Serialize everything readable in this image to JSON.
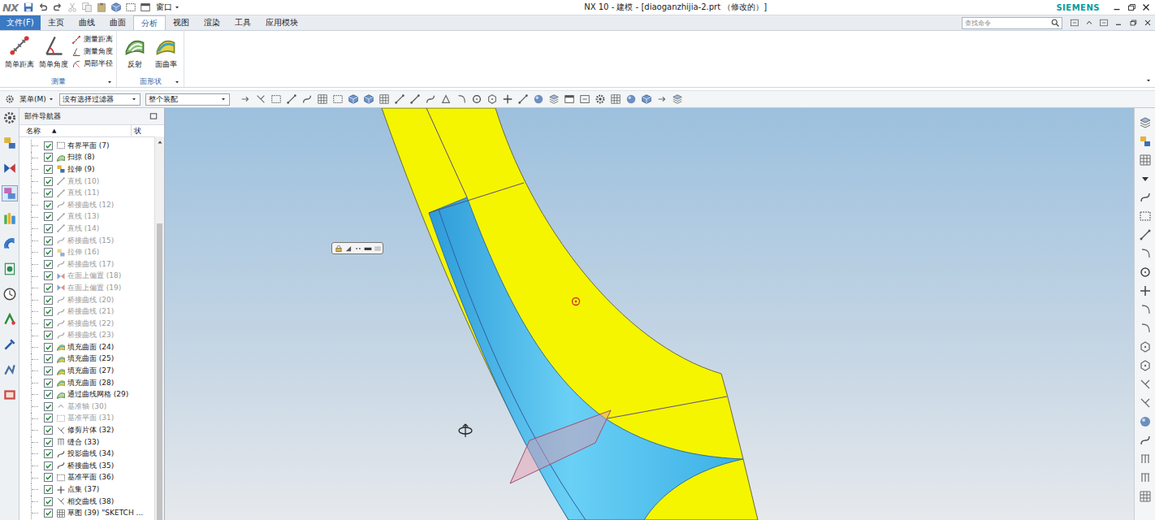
{
  "window": {
    "logo": "NX",
    "window_menu": "窗口",
    "title": "NX 10 - 建模 - [diaoganzhijia-2.prt （修改的）]",
    "brand": "SIEMENS"
  },
  "file_button": "文件(F)",
  "tabs": [
    {
      "label": "主页",
      "selected": false
    },
    {
      "label": "曲线",
      "selected": false
    },
    {
      "label": "曲面",
      "selected": false
    },
    {
      "label": "分析",
      "selected": true
    },
    {
      "label": "视图",
      "selected": false
    },
    {
      "label": "渲染",
      "selected": false
    },
    {
      "label": "工具",
      "selected": false
    },
    {
      "label": "应用模块",
      "selected": false
    }
  ],
  "command_search": {
    "placeholder": "查找命令"
  },
  "ribbon_groups": [
    {
      "label": "测量",
      "large_buttons": [
        "简单距离",
        "简单角度"
      ],
      "small_buttons": [
        "测量距离",
        "测量角度",
        "局部半径"
      ]
    },
    {
      "label": "面形状",
      "large_buttons": [
        "反射",
        "面曲率"
      ],
      "small_buttons": []
    }
  ],
  "selection_bar": {
    "menu": "菜单(M)",
    "filter": "没有选择过滤器",
    "scope": "整个装配"
  },
  "part_navigator": {
    "title": "部件导航器",
    "columns": [
      {
        "label": "名称",
        "sort": "▲"
      },
      {
        "label": "状"
      }
    ],
    "items": [
      {
        "label": "有界平面 (7)",
        "kind": "plane",
        "checked": true,
        "greyed": false
      },
      {
        "label": "扫掠 (8)",
        "kind": "sweep",
        "checked": true,
        "greyed": false
      },
      {
        "label": "拉伸 (9)",
        "kind": "extrude",
        "checked": true,
        "greyed": false
      },
      {
        "label": "直线 (10)",
        "kind": "line",
        "checked": true,
        "greyed": true
      },
      {
        "label": "直线 (11)",
        "kind": "line",
        "checked": true,
        "greyed": true
      },
      {
        "label": "桥接曲线 (12)",
        "kind": "bridge",
        "checked": true,
        "greyed": true
      },
      {
        "label": "直线 (13)",
        "kind": "line",
        "checked": true,
        "greyed": true
      },
      {
        "label": "直线 (14)",
        "kind": "line",
        "checked": true,
        "greyed": true
      },
      {
        "label": "桥接曲线 (15)",
        "kind": "bridge",
        "checked": true,
        "greyed": true
      },
      {
        "label": "拉伸 (16)",
        "kind": "extrude",
        "checked": true,
        "greyed": true
      },
      {
        "label": "桥接曲线 (17)",
        "kind": "bridge",
        "checked": true,
        "greyed": true
      },
      {
        "label": "在面上偏置 (18)",
        "kind": "offset",
        "checked": true,
        "greyed": true
      },
      {
        "label": "在面上偏置 (19)",
        "kind": "offset",
        "checked": true,
        "greyed": true
      },
      {
        "label": "桥接曲线 (20)",
        "kind": "bridge",
        "checked": true,
        "greyed": true
      },
      {
        "label": "桥接曲线 (21)",
        "kind": "bridge",
        "checked": true,
        "greyed": true
      },
      {
        "label": "桥接曲线 (22)",
        "kind": "bridge",
        "checked": true,
        "greyed": true
      },
      {
        "label": "桥接曲线 (23)",
        "kind": "bridge",
        "checked": true,
        "greyed": true
      },
      {
        "label": "填充曲面 (24)",
        "kind": "fill",
        "checked": true,
        "greyed": false
      },
      {
        "label": "填充曲面 (25)",
        "kind": "fill",
        "checked": true,
        "greyed": false
      },
      {
        "label": "填充曲面 (27)",
        "kind": "fill",
        "checked": true,
        "greyed": false
      },
      {
        "label": "填充曲面 (28)",
        "kind": "fill",
        "checked": true,
        "greyed": false
      },
      {
        "label": "通过曲线网格 (29)",
        "kind": "mesh",
        "checked": true,
        "greyed": false
      },
      {
        "label": "基准轴 (30)",
        "kind": "axis",
        "checked": true,
        "greyed": true
      },
      {
        "label": "基准平面 (31)",
        "kind": "datum",
        "checked": true,
        "greyed": true
      },
      {
        "label": "修剪片体 (32)",
        "kind": "trim",
        "checked": true,
        "greyed": false
      },
      {
        "label": "缝合 (33)",
        "kind": "sew",
        "checked": true,
        "greyed": false
      },
      {
        "label": "投影曲线 (34)",
        "kind": "project",
        "checked": true,
        "greyed": false
      },
      {
        "label": "桥接曲线 (35)",
        "kind": "bridge",
        "checked": true,
        "greyed": false
      },
      {
        "label": "基准平面 (36)",
        "kind": "datum",
        "checked": true,
        "greyed": false
      },
      {
        "label": "点集 (37)",
        "kind": "point",
        "checked": true,
        "greyed": false
      },
      {
        "label": "相交曲线 (38)",
        "kind": "intersect",
        "checked": true,
        "greyed": false
      },
      {
        "label": "草图 (39) \"SKETCH ...",
        "kind": "sketch",
        "checked": true,
        "greyed": false
      }
    ]
  }
}
